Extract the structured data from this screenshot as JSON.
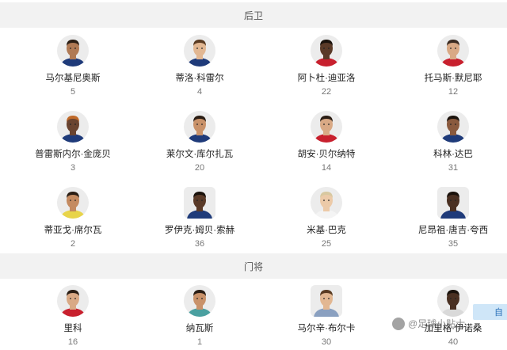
{
  "sections": [
    {
      "title": "后卫",
      "players": [
        {
          "name": "马尔基尼奥斯",
          "number": "5",
          "skin": "#b07a55",
          "hair": "#2a1d14",
          "kit": "#1f3b7a"
        },
        {
          "name": "蒂洛·科雷尔",
          "number": "4",
          "skin": "#e2b792",
          "hair": "#5a3b22",
          "kit": "#1f3b7a"
        },
        {
          "name": "阿卜杜·迪亚洛",
          "number": "22",
          "skin": "#5a3a28",
          "hair": "#1a120c",
          "kit": "#c8202e"
        },
        {
          "name": "托马斯·默尼耶",
          "number": "12",
          "skin": "#d9a985",
          "hair": "#3a2a20",
          "kit": "#c8202e"
        },
        {
          "name": "普雷斯内尔·金庞贝",
          "number": "3",
          "skin": "#6a4430",
          "hair": "#c06a2a",
          "kit": "#1f3b7a"
        },
        {
          "name": "莱尔文·库尔扎瓦",
          "number": "20",
          "skin": "#c9926a",
          "hair": "#2a1d14",
          "kit": "#1f3b7a"
        },
        {
          "name": "胡安·贝尔纳特",
          "number": "14",
          "skin": "#d9a985",
          "hair": "#2a1d14",
          "kit": "#c8202e"
        },
        {
          "name": "科林·达巴",
          "number": "31",
          "skin": "#8a5a3e",
          "hair": "#1a120c",
          "kit": "#1f3b7a"
        },
        {
          "name": "蒂亚戈·席尔瓦",
          "number": "2",
          "skin": "#c48a60",
          "hair": "#2a1d14",
          "kit": "#e8d44a"
        },
        {
          "name": "罗伊克·姆贝·索赫",
          "number": "36",
          "skin": "#5a3a28",
          "hair": "#1a120c",
          "kit": "#1f3b7a"
        },
        {
          "name": "米基·巴克",
          "number": "25",
          "skin": "#eccaa8",
          "hair": "#d8c8a0",
          "kit": "#f4f4f4"
        },
        {
          "name": "尼昂祖·唐吉·夸西",
          "number": "35",
          "skin": "#4a3022",
          "hair": "#1a120c",
          "kit": "#1f3b7a"
        }
      ]
    },
    {
      "title": "门将",
      "players": [
        {
          "name": "里科",
          "number": "16",
          "skin": "#d9a985",
          "hair": "#2a1d14",
          "kit": "#c8202e"
        },
        {
          "name": "纳瓦斯",
          "number": "1",
          "skin": "#c9926a",
          "hair": "#2a1d14",
          "kit": "#4aa0a0"
        },
        {
          "name": "马尔辛·布尔卡",
          "number": "30",
          "skin": "#e2b792",
          "hair": "#5a3b22",
          "kit": "#8aa0c0"
        },
        {
          "name": "加里格·伊诺桑",
          "number": "40",
          "skin": "#4a3022",
          "hair": "#1a120c",
          "kit": "#d9d9d9"
        }
      ]
    }
  ],
  "side_button": {
    "label": "自"
  },
  "watermark": {
    "text": "@足球小贴士"
  }
}
